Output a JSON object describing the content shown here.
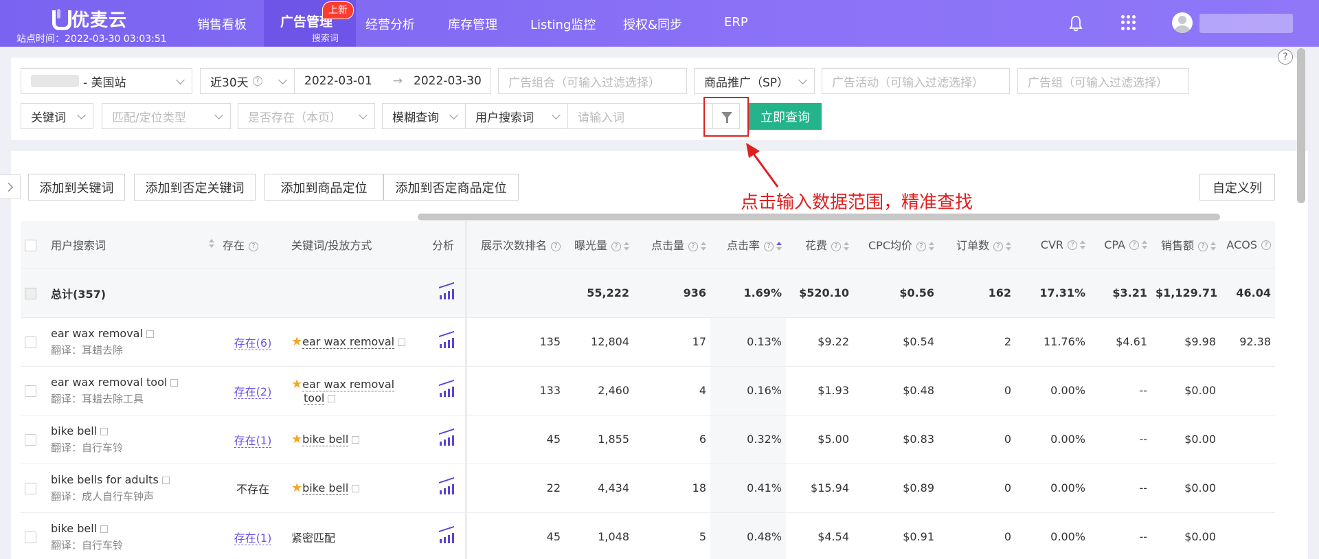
{
  "brand": {
    "logo_text": "优麦云",
    "site_time": "站点时间：2022-03-30 03:03:51"
  },
  "nav": {
    "items": [
      "销售看板",
      "经营分析",
      "库存管理",
      "Listing监控",
      "授权&同步",
      "ERP"
    ],
    "active": {
      "label": "广告管理",
      "sub": "搜索词",
      "badge": "上新"
    }
  },
  "filters": {
    "store": "- 美国站",
    "range": "近30天",
    "date_start": "2022-03-01",
    "date_end": "2022-03-30",
    "portfolio_placeholder": "广告组合（可输入过滤选择）",
    "ad_type": "商品推广（SP）",
    "campaign_placeholder": "广告活动（可输入过滤选择）",
    "adgroup_placeholder": "广告组（可输入过滤选择）",
    "keyword_type": "关键词",
    "match_placeholder": "匹配/定位类型",
    "exists_placeholder": "是否存在（本页）",
    "fuzzy": "模糊查询",
    "field": "用户搜索词",
    "input_placeholder": "请输入词",
    "query_button": "立即查询"
  },
  "actions": [
    "添加到关键词",
    "添加到否定关键词",
    "添加到商品定位",
    "添加到否定商品定位"
  ],
  "custom_columns": "自定义列",
  "annotation": "点击输入数据范围，精准查找",
  "columns": [
    "用户搜索词",
    "存在",
    "关键词/投放方式",
    "分析",
    "展示次数排名",
    "曝光量",
    "点击量",
    "点击率",
    "花费",
    "CPC均价",
    "订单数",
    "CVR",
    "CPA",
    "销售额",
    "ACOS"
  ],
  "total": {
    "label": "总计(357)",
    "impressions": "55,222",
    "clicks": "936",
    "ctr": "1.69%",
    "spend": "$520.10",
    "cpc": "$0.56",
    "orders": "162",
    "cvr": "17.31%",
    "cpa": "$3.21",
    "sales": "$1,129.71",
    "acos": "46.04"
  },
  "rows": [
    {
      "term": "ear wax removal",
      "trans": "翻译：耳蜡去除",
      "exist": "存在(6)",
      "kw": "ear wax removal",
      "kw2": "",
      "rank": "135",
      "impressions": "12,804",
      "clicks": "17",
      "ctr": "0.13%",
      "spend": "$9.22",
      "cpc": "$0.54",
      "orders": "2",
      "cvr": "11.76%",
      "cpa": "$4.61",
      "sales": "$9.98",
      "acos": "92.38"
    },
    {
      "term": "ear wax removal tool",
      "trans": "翻译：耳蜡去除工具",
      "exist": "存在(2)",
      "kw": "ear wax removal",
      "kw2": "tool",
      "rank": "133",
      "impressions": "2,460",
      "clicks": "4",
      "ctr": "0.16%",
      "spend": "$1.93",
      "cpc": "$0.48",
      "orders": "0",
      "cvr": "0.00%",
      "cpa": "--",
      "sales": "$0.00",
      "acos": ""
    },
    {
      "term": "bike bell",
      "trans": "翻译：自行车铃",
      "exist": "存在(1)",
      "kw": "bike bell",
      "kw2": "",
      "rank": "45",
      "impressions": "1,855",
      "clicks": "6",
      "ctr": "0.32%",
      "spend": "$5.00",
      "cpc": "$0.83",
      "orders": "0",
      "cvr": "0.00%",
      "cpa": "--",
      "sales": "$0.00",
      "acos": ""
    },
    {
      "term": "bike bells for adults",
      "trans": "翻译：成人自行车钟声",
      "exist": "不存在",
      "kw": "bike bell",
      "kw2": "",
      "rank": "22",
      "impressions": "4,434",
      "clicks": "18",
      "ctr": "0.41%",
      "spend": "$15.94",
      "cpc": "$0.89",
      "orders": "0",
      "cvr": "0.00%",
      "cpa": "--",
      "sales": "$0.00",
      "acos": ""
    },
    {
      "term": "bike bell",
      "trans": "翻译：自行车铃",
      "exist": "存在(1)",
      "kw": "紧密匹配",
      "kw2": "",
      "rank": "45",
      "impressions": "1,048",
      "clicks": "5",
      "ctr": "0.48%",
      "spend": "$4.54",
      "cpc": "$0.91",
      "orders": "0",
      "cvr": "0.00%",
      "cpa": "--",
      "sales": "$0.00",
      "acos": ""
    }
  ],
  "colors": {
    "nav": "#7b68ee",
    "accent": "#6e55e8",
    "primary_button": "#23b48b",
    "annotation": "#e02020"
  }
}
